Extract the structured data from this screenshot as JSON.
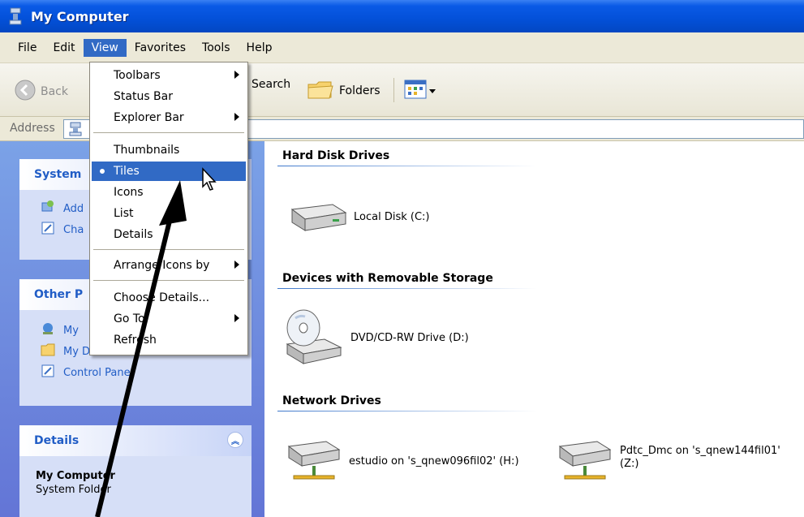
{
  "window": {
    "title": "My Computer"
  },
  "menubar": {
    "items": [
      "File",
      "Edit",
      "View",
      "Favorites",
      "Tools",
      "Help"
    ]
  },
  "toolbar": {
    "back_label": "Back",
    "search_label": "Search",
    "folders_label": "Folders"
  },
  "address": {
    "label": "Address"
  },
  "view_menu": {
    "items": [
      {
        "label": "Toolbars",
        "submenu": true
      },
      {
        "label": "Status Bar"
      },
      {
        "label": "Explorer Bar",
        "submenu": true
      },
      {
        "label": "Thumbnails"
      },
      {
        "label": "Tiles",
        "selected": true
      },
      {
        "label": "Icons"
      },
      {
        "label": "List"
      },
      {
        "label": "Details"
      },
      {
        "label": "Arrange Icons by",
        "submenu": true
      },
      {
        "label": "Choose Details..."
      },
      {
        "label": "Go To",
        "submenu": true
      },
      {
        "label": "Refresh"
      }
    ]
  },
  "left_panel": {
    "system_tasks": {
      "title": "System",
      "links": [
        "Add",
        "Cha"
      ]
    },
    "other_places": {
      "title": "Other P",
      "links": [
        "My",
        "My Documents",
        "Control Panel"
      ]
    },
    "details": {
      "title": "Details",
      "name": "My Computer",
      "type": "System Folder"
    }
  },
  "content": {
    "groups": [
      {
        "title": "Hard Disk Drives",
        "items": [
          "Local Disk (C:)"
        ]
      },
      {
        "title": "Devices with Removable Storage",
        "items": [
          "DVD/CD-RW Drive (D:)"
        ]
      },
      {
        "title": "Network Drives",
        "items": [
          "estudio on 's_qnew096fil02' (H:)",
          "Pdtc_Dmc on 's_qnew144fil01'",
          "(Z:)"
        ]
      }
    ]
  },
  "colors": {
    "titlebar": "#0350d8",
    "menu_highlight": "#316ac5",
    "panel_link": "#215dc6"
  }
}
